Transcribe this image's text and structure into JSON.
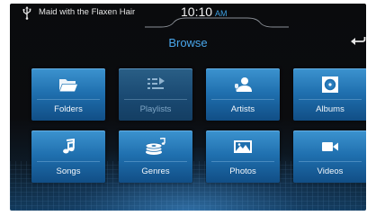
{
  "status": {
    "track_title": "Maid with the Flaxen Hair",
    "time": "10:10",
    "ampm": "AM"
  },
  "browse": {
    "title": "Browse"
  },
  "tiles": [
    {
      "label": "Folders",
      "icon": "folder-icon",
      "enabled": true
    },
    {
      "label": "Playlists",
      "icon": "playlist-icon",
      "enabled": false
    },
    {
      "label": "Artists",
      "icon": "artist-icon",
      "enabled": true
    },
    {
      "label": "Albums",
      "icon": "album-icon",
      "enabled": true
    },
    {
      "label": "Songs",
      "icon": "music-note-icon",
      "enabled": true
    },
    {
      "label": "Genres",
      "icon": "genres-icon",
      "enabled": true
    },
    {
      "label": "Photos",
      "icon": "photo-icon",
      "enabled": true
    },
    {
      "label": "Videos",
      "icon": "video-camera-icon",
      "enabled": true
    }
  ],
  "colors": {
    "accent": "#49a6ea",
    "tile_top": "#3c93cf",
    "tile_bottom": "#114e86"
  }
}
